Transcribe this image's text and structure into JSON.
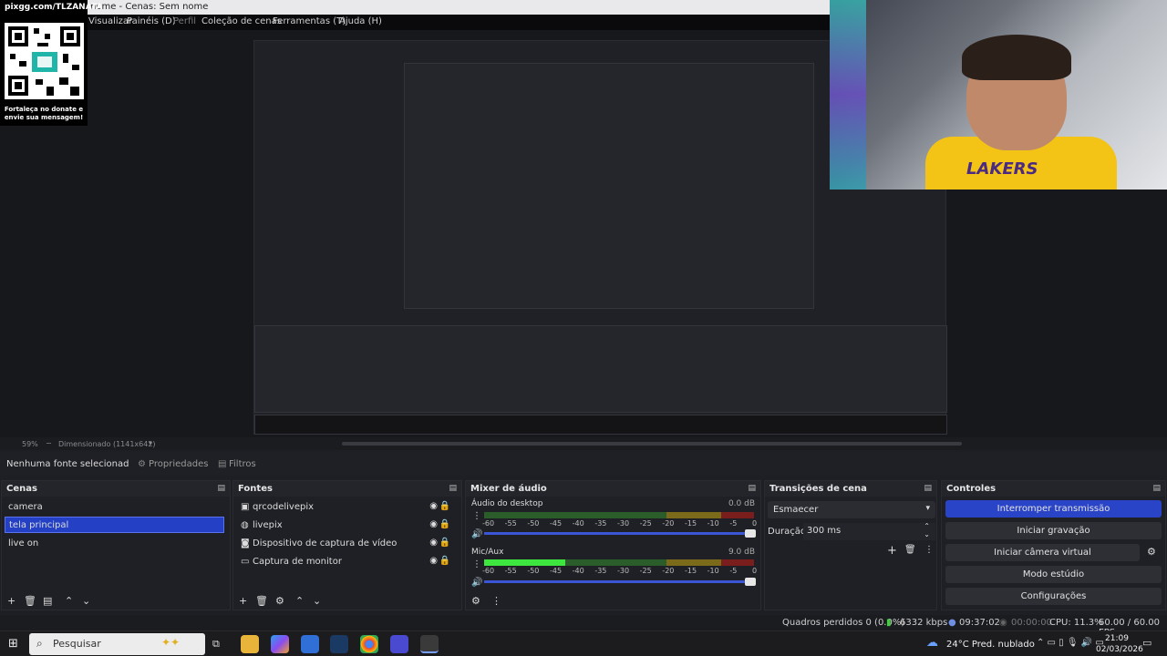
{
  "window": {
    "title": "nome - Cenas: Sem nome"
  },
  "menu": [
    "Visualizar",
    "Painéis (D)",
    "Perfil",
    "Coleção de cenas",
    "Ferramentas (T)",
    "Ajuda (H)"
  ],
  "donation": {
    "url": "pixgg.com/TLZANATA",
    "note": "Fortaleça no donate e envie sua mensagem!"
  },
  "webcam": {
    "jersey_text": "LAKERS"
  },
  "zoom": {
    "percent": "59%",
    "scaling": "Dimensionado (1141x642)"
  },
  "props": {
    "no_source": "Nenhuma fonte selecionad",
    "properties": "Propriedades",
    "filters": "Filtros"
  },
  "scenes": {
    "title": "Cenas",
    "items": [
      "camera",
      "tela principal",
      "live on"
    ],
    "selected": 1
  },
  "sources": {
    "title": "Fontes",
    "items": [
      "qrcodelivepix",
      "livepix",
      "Dispositivo de captura de vídeo",
      "Captura de monitor"
    ]
  },
  "mixer": {
    "title": "Mixer de áudio",
    "channels": [
      {
        "name": "Áudio do desktop",
        "db": "0.0 dB",
        "level": 0.0
      },
      {
        "name": "Mic/Aux",
        "db": "9.0 dB",
        "level": 0.3
      }
    ],
    "ticks": [
      "-60",
      "-55",
      "-50",
      "-45",
      "-40",
      "-35",
      "-30",
      "-25",
      "-20",
      "-15",
      "-10",
      "-5",
      "0"
    ]
  },
  "transitions": {
    "title": "Transições de cena",
    "selected": "Esmaecer",
    "duration_label": "Duração",
    "duration": "300 ms"
  },
  "controls": {
    "title": "Controles",
    "buttons": [
      "Interromper transmissão",
      "Iniciar gravação",
      "Iniciar câmera virtual",
      "Modo estúdio",
      "Configurações"
    ]
  },
  "status": {
    "dropped": "Quadros perdidos 0 (0.0%)",
    "bitrate": "6332 kbps",
    "live_time": "09:37:02",
    "rec_time": "00:00:00",
    "cpu": "CPU: 11.3%",
    "fps": "60.00 / 60.00 FPS"
  },
  "taskbar": {
    "search": "Pesquisar",
    "weather": "24°C  Pred. nublado",
    "time": "21:09",
    "date": "02/03/2026"
  }
}
